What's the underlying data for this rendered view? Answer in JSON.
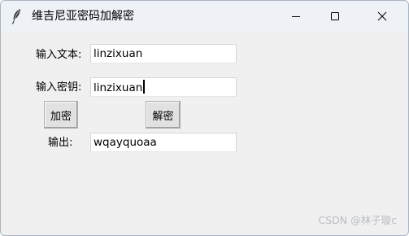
{
  "window": {
    "title": "维吉尼亚密码加解密",
    "controls": {
      "minimize_icon": "minimize-icon",
      "maximize_icon": "maximize-icon",
      "close_icon": "close-icon"
    },
    "app_icon": "feather-icon"
  },
  "form": {
    "plaintext_label": "输入文本:",
    "plaintext_value": "linzixuan",
    "key_label": "输入密钥:",
    "key_value": "linzixuan",
    "encrypt_button": "加密",
    "decrypt_button": "解密",
    "output_label": "输出:",
    "output_value": "wqayquoaa"
  },
  "watermark": "CSDN @林子璇c",
  "colors": {
    "window_bg": "#f0f0f0",
    "titlebar_bg": "#eef1f6",
    "button_bg": "#e1e1e1",
    "field_bg": "#ffffff"
  }
}
